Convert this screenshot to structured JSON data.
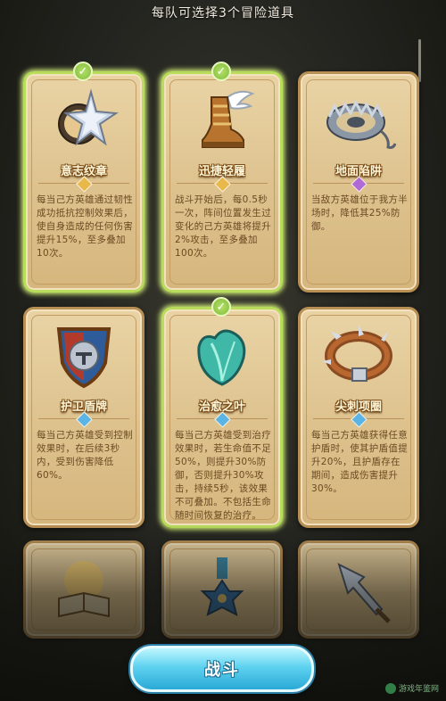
{
  "header": {
    "title": "每队可选择3个冒险道具"
  },
  "cards": [
    {
      "name": "意志纹章",
      "selected": true,
      "gem": "gold",
      "gem_color": "#e8b84a",
      "icon": "crest-star-icon",
      "desc": "每当己方英雄通过韧性成功抵抗控制效果后，使自身造成的任何伤害提升15%，至多叠加10次。"
    },
    {
      "name": "迅捷轻履",
      "selected": true,
      "gem": "gold",
      "gem_color": "#e8b84a",
      "icon": "winged-boot-icon",
      "desc": "战斗开始后，每0.5秒一次，阵间位置发生过变化的己方英雄将提升2%攻击，至多叠加100次。"
    },
    {
      "name": "地面陷阱",
      "selected": false,
      "gem": "purple",
      "gem_color": "#b06ad8",
      "icon": "bear-trap-icon",
      "desc": "当敌方英雄位于我方半场时，降低其25%防御。"
    },
    {
      "name": "护卫盾牌",
      "selected": false,
      "gem": "blue",
      "gem_color": "#5ab4e6",
      "icon": "knight-shield-icon",
      "desc": "每当己方英雄受到控制效果时，在后续3秒内，受到伤害降低60%。"
    },
    {
      "name": "治愈之叶",
      "selected": true,
      "gem": "blue",
      "gem_color": "#5ab4e6",
      "icon": "healing-leaf-icon",
      "desc": "每当己方英雄受到治疗效果时，若生命值不足50%，则提升30%防御，否则提升30%攻击，持续5秒，该效果不可叠加。不包括生命随时间恢复的治疗。"
    },
    {
      "name": "尖刺项圈",
      "selected": false,
      "gem": "blue",
      "gem_color": "#5ab4e6",
      "icon": "spiked-collar-icon",
      "desc": "每当己方英雄获得任意护盾时，使其护盾值提升20%，且护盾存在期间，造成伤害提升30%。"
    }
  ],
  "partial_cards": [
    {
      "icon": "glowing-book-icon"
    },
    {
      "icon": "cross-medal-icon"
    },
    {
      "icon": "spear-tip-icon"
    }
  ],
  "battle_button": {
    "label": "战斗"
  },
  "watermark": {
    "text": "游戏年鉴网"
  }
}
